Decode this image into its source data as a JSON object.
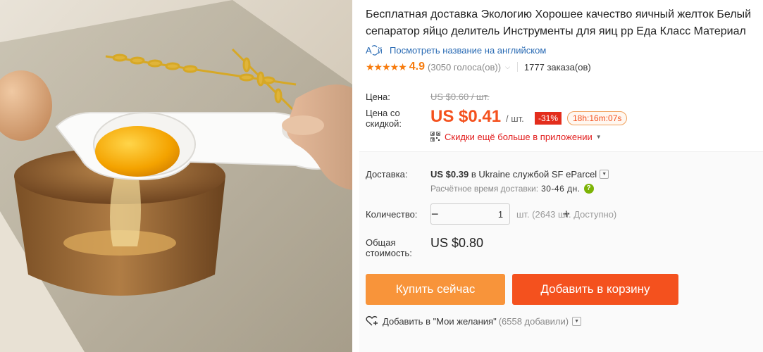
{
  "product": {
    "title_line1": "Бесплатная доставка Экологию Хорошее качество яичный желток Белый",
    "title_line2": "сепаратор яйцо делитель Инструменты для яиц pp Еда Класс Материал"
  },
  "translate": {
    "label": "Посмотреть название на английском",
    "icon": "translate-icon"
  },
  "rating": {
    "stars": "★★★★★",
    "value": "4.9",
    "votes": "(3050 голоса(ов))",
    "orders": "1777 заказа(ов)"
  },
  "price": {
    "label_price": "Цена:",
    "old_price": "US $0.60 / шт.",
    "label_sale_1": "Цена со",
    "label_sale_2": "скидкой:",
    "sale_price": "US $0.41",
    "per_unit": "/ шт.",
    "discount": "-31%",
    "timer": "18h:16m:07s",
    "app_promo": "Скидки ещё больше в приложении"
  },
  "shipping": {
    "label": "Доставка:",
    "cost": "US $0.39",
    "to_word": " в ",
    "country": "Ukraine",
    "by_word": " службой ",
    "service": "SF eParcel",
    "eta_label": "Расчётное время доставки:",
    "eta_days": "30-46 дн."
  },
  "quantity": {
    "label": "Количество:",
    "value": "1",
    "minus": "−",
    "plus": "+",
    "available": "шт. (2643 шт. Доступно)"
  },
  "total": {
    "label_1": "Общая",
    "label_2": "стоимость:",
    "value": "US $0.80"
  },
  "actions": {
    "buy_now": "Купить сейчас",
    "add_to_cart": "Добавить в корзину",
    "wishlist": "Добавить в \"Мои желания\"",
    "wishlist_count": "(6558 добавили)"
  },
  "colors": {
    "accent_orange": "#f4511e",
    "buy_button": "#f8943a",
    "star": "#f77b0d",
    "promo_red": "#e21d1d",
    "link_blue": "#2a6bb4"
  }
}
